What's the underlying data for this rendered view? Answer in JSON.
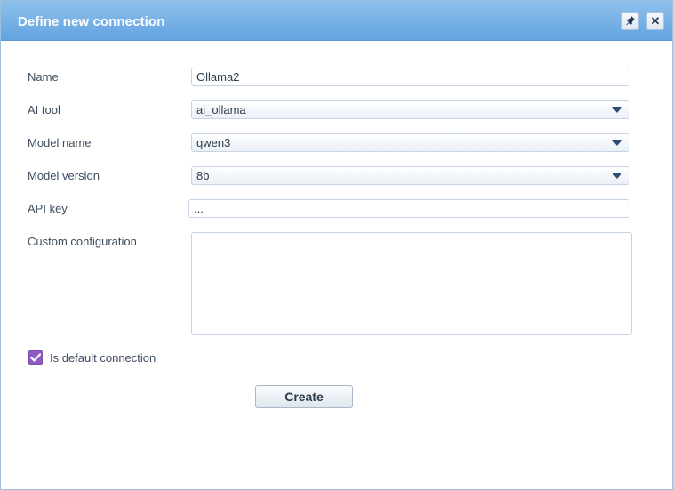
{
  "dialog": {
    "title": "Define new connection",
    "pin_icon": "pin-icon",
    "close_icon": "close-icon",
    "close_glyph": "✕"
  },
  "form": {
    "name": {
      "label": "Name",
      "value": "Ollama2"
    },
    "ai_tool": {
      "label": "AI tool",
      "value": "ai_ollama"
    },
    "model_name": {
      "label": "Model name",
      "value": "qwen3"
    },
    "model_version": {
      "label": "Model version",
      "value": "8b"
    },
    "api_key": {
      "label": "API key",
      "value": "..."
    },
    "custom_config": {
      "label": "Custom configuration",
      "value": ""
    },
    "is_default": {
      "label": "Is default connection",
      "checked": true
    }
  },
  "actions": {
    "create_label": "Create"
  },
  "colors": {
    "titlebar": "#6aa9e3",
    "checkbox": "#8e5bc2",
    "border": "#c5d3e2"
  }
}
